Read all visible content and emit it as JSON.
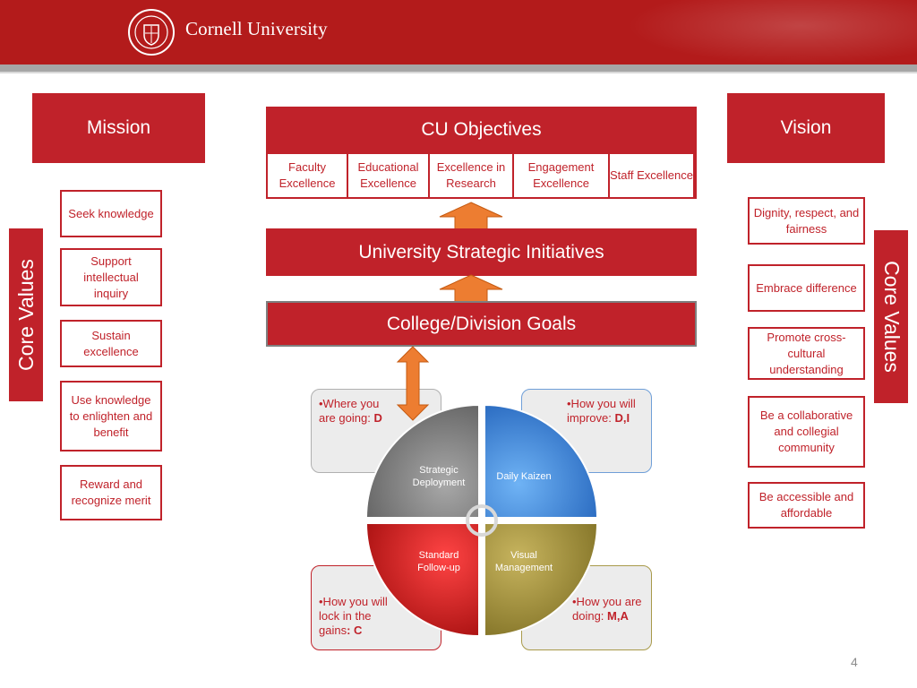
{
  "header": {
    "brand": "Cornell University",
    "seal_alt": "cornell-seal"
  },
  "mission": {
    "title": "Mission",
    "items": [
      "Seek knowledge",
      "Support intellectual inquiry",
      "Sustain excellence",
      "Use knowledge to enlighten and benefit",
      "Reward and recognize merit"
    ]
  },
  "vision": {
    "title": "Vision",
    "items": [
      "Dignity, respect, and fairness",
      "Embrace difference",
      "Promote cross-cultural understanding",
      "Be a collaborative and collegial community",
      "Be accessible and affordable"
    ]
  },
  "core_values_label": "Core Values",
  "objectives": {
    "title": "CU Objectives",
    "cells": [
      "Faculty Excellence",
      "Educational Excellence",
      "Excellence in Research",
      "Engagement Excellence",
      "Staff Excellence"
    ]
  },
  "initiatives": "University Strategic Initiatives",
  "goals": "College/Division Goals",
  "quadrants": {
    "strategic": "Strategic Deployment",
    "kaizen": "Daily Kaizen",
    "followup": "Standard Follow-up",
    "visual": "Visual Management"
  },
  "notes": {
    "tl": {
      "text": "•Where you are going: ",
      "bold": "D"
    },
    "tr": {
      "text": "•How you will improve: ",
      "bold": "D,I"
    },
    "bl": {
      "text": "•How you will lock in the gains",
      "bold": ": C"
    },
    "br": {
      "text": "•How you are doing: ",
      "bold": "M,A"
    }
  },
  "page_number": "4",
  "colors": {
    "brand_red": "#b31b1b",
    "box_red": "#c0222a",
    "arrow_orange": "#ed7d31",
    "blue": "#2e75d6",
    "gray": "#6f6f6f",
    "olive": "#8f7f2e"
  }
}
